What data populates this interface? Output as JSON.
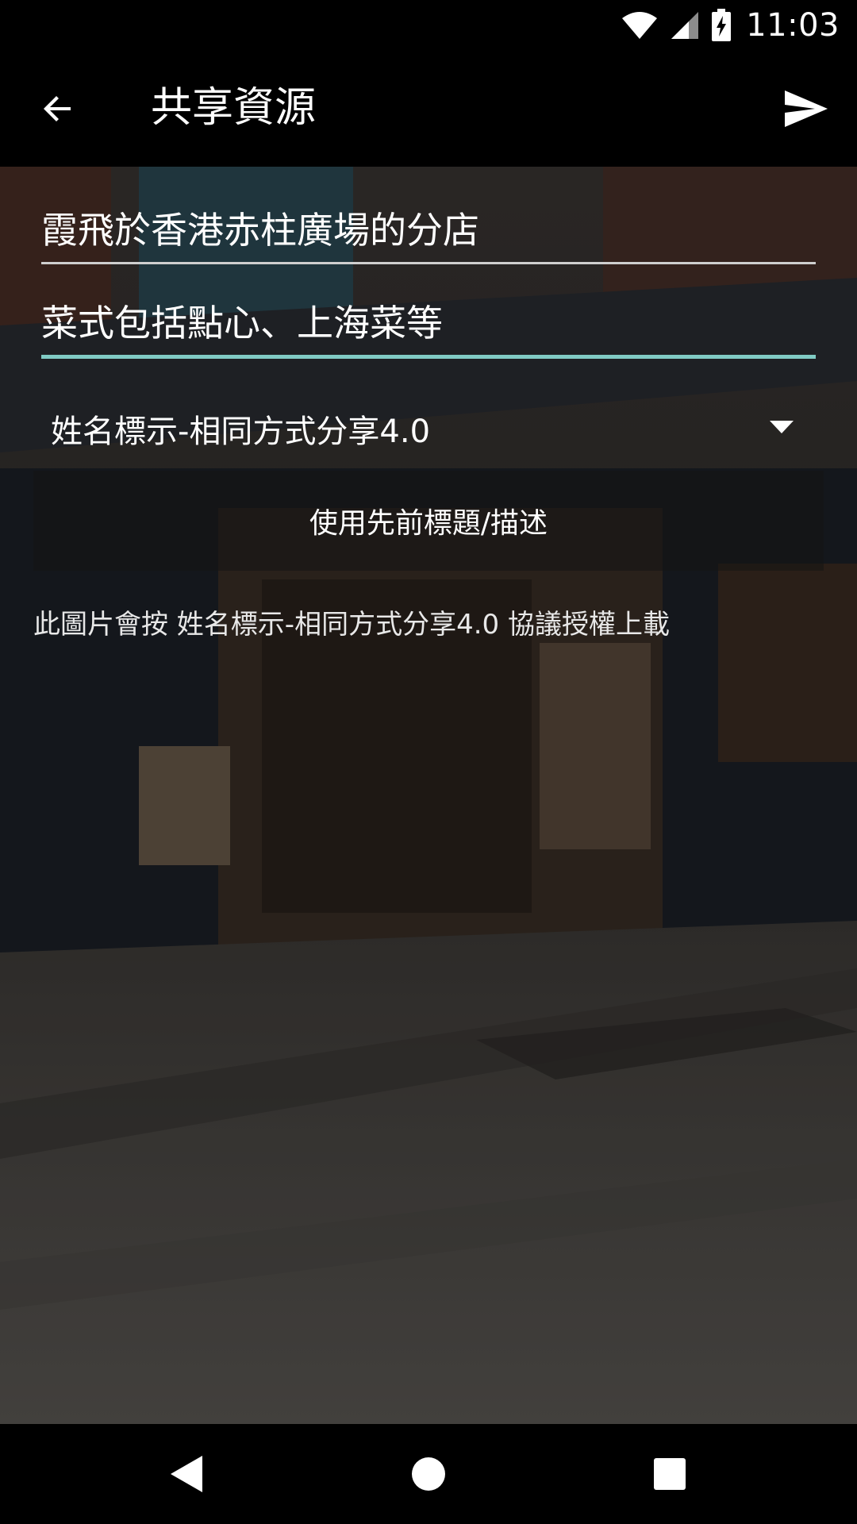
{
  "status_bar": {
    "time": "11:03",
    "icons": [
      "wifi-icon",
      "cell-signal-icon",
      "battery-charging-icon"
    ]
  },
  "app_bar": {
    "title": "共享資源",
    "back_icon": "arrow-back-icon",
    "send_icon": "send-icon"
  },
  "form": {
    "title_value": "霞飛於香港赤柱廣場的分店",
    "description_value": "菜式包括點心、上海菜等",
    "license_selected": "姓名標示-相同方式分享4.0",
    "use_previous_button": "使用先前標題/描述",
    "license_note": "此圖片會按 姓名標示-相同方式分享4.0 協議授權上載"
  },
  "colors": {
    "accent": "#80cbc4",
    "underline": "#cfcfcf",
    "bar_background": "#000000"
  },
  "nav_bar": {
    "icons": [
      "back-triangle-icon",
      "home-circle-icon",
      "recents-square-icon"
    ]
  }
}
